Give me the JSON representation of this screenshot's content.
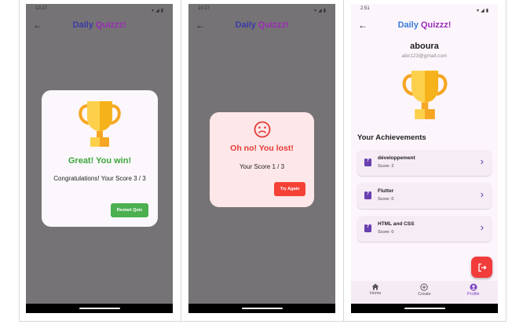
{
  "colors": {
    "overlay": "#757375",
    "win_green": "#3da63b",
    "lose_red": "#e53935",
    "title_blue": "#3b3aa8",
    "title_purple": "#9b2bb8",
    "accent_purple": "#7a3fc0"
  },
  "screen_win": {
    "status_time": "10:27",
    "app_title_a": "Daily",
    "app_title_b": "Quizzz!",
    "dialog": {
      "title": "Great! You win!",
      "message": "Congratulations! Your Score 3 / 3",
      "button_label": "Restart Quiz"
    }
  },
  "screen_lose": {
    "status_time": "10:27",
    "app_title_a": "Daily",
    "app_title_b": "Quizzz!",
    "dialog": {
      "icon": "sad-face-icon",
      "title": "Oh no! You lost!",
      "message": "Your Score 1 / 3",
      "button_label": "Try Again"
    }
  },
  "screen_profile": {
    "status_time": "2:51",
    "app_title_a": "Daily",
    "app_title_b": "Quizzz!",
    "username": "aboura",
    "email": "abir123@gmail.com",
    "achievements_heading": "Your Achievements",
    "achievements": [
      {
        "title": "développement",
        "score": "Score: 2"
      },
      {
        "title": "Flutter",
        "score": "Score: 0"
      },
      {
        "title": "HTML and CSS",
        "score": "Score: 0"
      }
    ],
    "nav": [
      {
        "label": "Home",
        "icon": "home-icon"
      },
      {
        "label": "Create",
        "icon": "add-circle-icon"
      },
      {
        "label": "Profile",
        "icon": "profile-icon"
      }
    ]
  }
}
